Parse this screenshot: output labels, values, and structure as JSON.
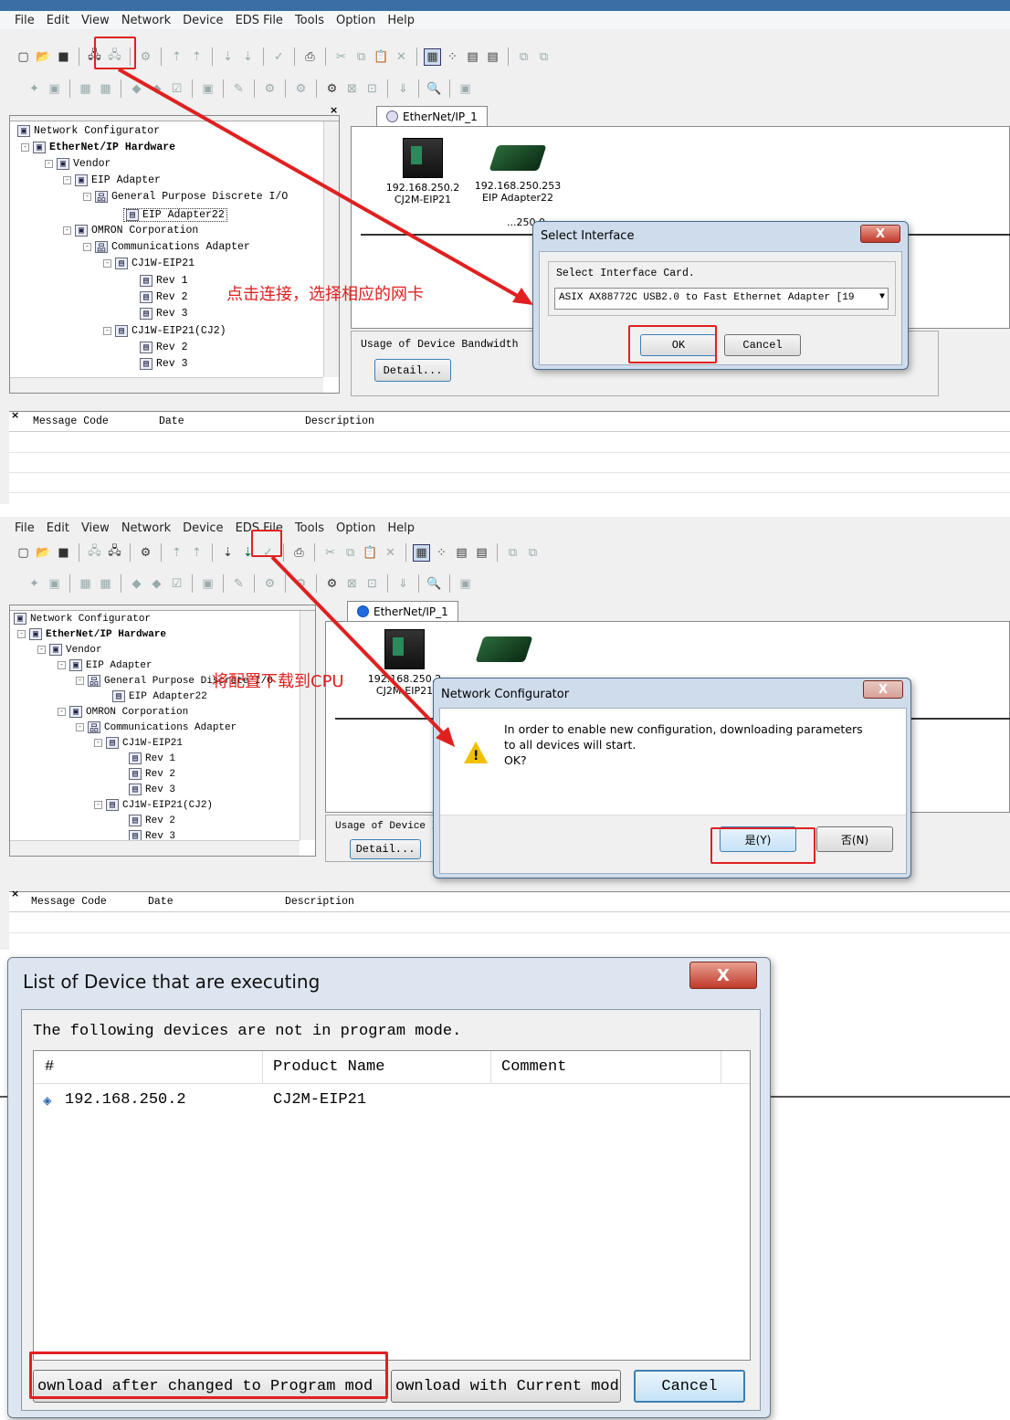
{
  "menu": [
    "File",
    "Edit",
    "View",
    "Network",
    "Device",
    "EDS File",
    "Tools",
    "Option",
    "Help"
  ],
  "tree": {
    "items": [
      {
        "label": "Network Configurator",
        "bold": false
      },
      {
        "label": "EtherNet/IP Hardware",
        "bold": true
      },
      {
        "label": "Vendor",
        "bold": false
      },
      {
        "label": "EIP Adapter",
        "bold": false
      },
      {
        "label": "General Purpose Discrete I/O",
        "bold": false
      },
      {
        "label": "EIP Adapter22",
        "bold": false
      },
      {
        "label": "OMRON Corporation",
        "bold": false
      },
      {
        "label": "Communications Adapter",
        "bold": false
      },
      {
        "label": "CJ1W-EIP21",
        "bold": false
      },
      {
        "label": "Rev 1",
        "bold": false
      },
      {
        "label": "Rev 2",
        "bold": false
      },
      {
        "label": "Rev 3",
        "bold": false
      },
      {
        "label": "CJ1W-EIP21(CJ2)",
        "bold": false
      },
      {
        "label": "Rev 2",
        "bold": false
      },
      {
        "label": "Rev 3",
        "bold": false
      }
    ]
  },
  "network_tab": "EtherNet/IP_1",
  "devices": [
    {
      "ip": "192.168.250.2",
      "name": "CJ2M-EIP21"
    },
    {
      "ip": "192.168.250.253",
      "name": "EIP Adapter22"
    }
  ],
  "bandwidth": {
    "label": "Usage of Device Bandwidth",
    "detail_button": "Detail...",
    "label_short": "Usage of Device I"
  },
  "messages": {
    "code": "Message Code",
    "date": "Date",
    "description": "Description"
  },
  "panel1": {
    "annotation": "点击连接，选择相应的网卡",
    "dialog": {
      "title": "Select Interface",
      "group_label": "Select Interface Card.",
      "selected_card": "ASIX AX88772C USB2.0 to Fast Ethernet Adapter [19",
      "ok": "OK",
      "cancel": "Cancel",
      "close": "X"
    },
    "partial_label": "...250.0"
  },
  "panel2": {
    "annotation": "将配置下载到CPU",
    "dialog": {
      "title": "Network Configurator",
      "message_line1": "In order to enable new configuration, downloading parameters",
      "message_line2": "to all devices will start.",
      "message_line3": "OK?",
      "yes": "是(Y)",
      "no": "否(N)",
      "close": "X"
    }
  },
  "panel3": {
    "title": "List of Device that are executing",
    "close": "X",
    "subtitle": "The following devices are not in program mode.",
    "columns": [
      "#",
      "Product Name",
      "Comment"
    ],
    "rows": [
      {
        "ip": "192.168.250.2",
        "product": "CJ2M-EIP21",
        "comment": ""
      }
    ],
    "btn_program": "ownload after changed to Program mod",
    "btn_current": "ownload with Current mod",
    "btn_cancel": "Cancel"
  },
  "colors": {
    "accent_red": "#e02020",
    "window_bg": "#f0f0f0",
    "dialog_frame": "#cfdcec"
  }
}
